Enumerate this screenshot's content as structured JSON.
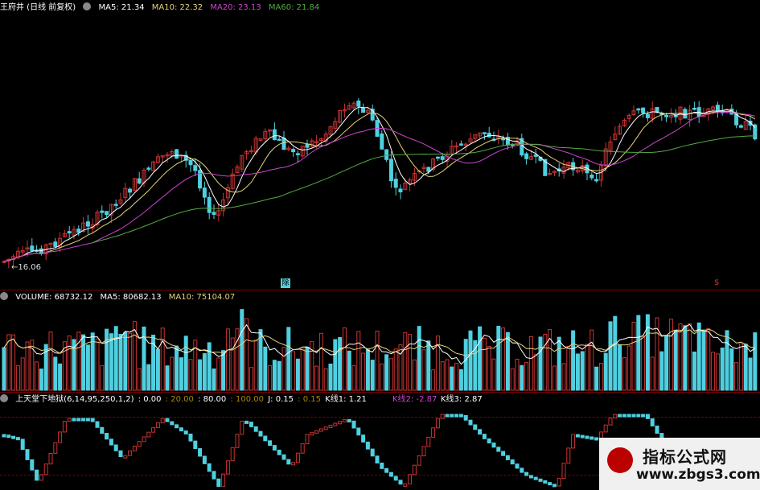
{
  "price_panel": {
    "title": "王府井 (日线 前复权)",
    "ma5": "MA5: 21.34",
    "ma10": "MA10: 22.32",
    "ma20": "MA20: 23.13",
    "ma60": "MA60: 21.84",
    "low_label": "←16.06",
    "marker_label": "除",
    "marker2_label": "$"
  },
  "volume_panel": {
    "title": "VOLUME: 68732.12",
    "ma5": "MA5: 80682.13",
    "ma10": "MA10: 75104.07"
  },
  "indicator_panel": {
    "title": "上天堂下地狱(6,14,95,250,1,2)",
    "v1": ": 0.00",
    "v2": ": 20.00",
    "v3": ": 80.00",
    "v4": ": 100.00",
    "j": "J: 0.15",
    "v5": ": 0.15",
    "k1": "K线1: 1.21",
    "k2": "K线2: -2.87",
    "k3": "K线3: 2.87"
  },
  "watermark": {
    "line1": "指标公式网",
    "line2": "www.zbgs3.com"
  },
  "colors": {
    "up": "#cc3333",
    "down": "#4fd0e0",
    "ma5": "#ffffff",
    "ma10": "#e6d27a",
    "ma20": "#cc44cc",
    "ma60": "#55aa44"
  }
}
